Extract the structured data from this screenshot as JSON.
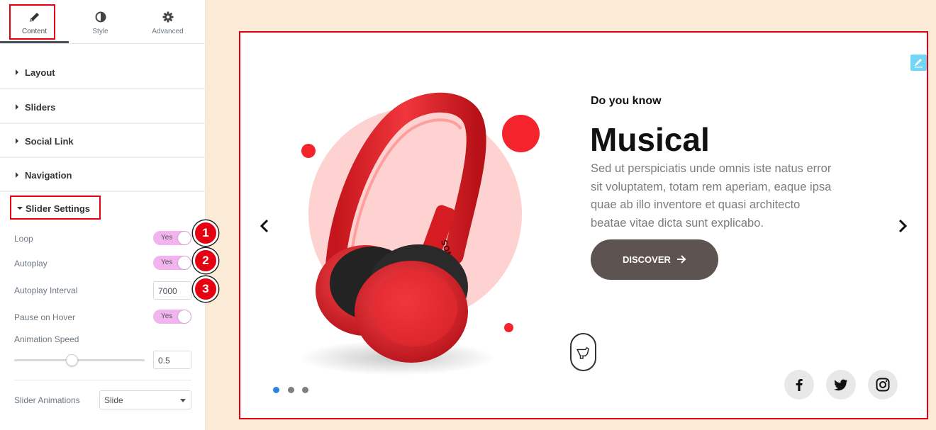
{
  "tabs": [
    {
      "label": "Content",
      "icon": "pencil-icon",
      "active": true
    },
    {
      "label": "Style",
      "icon": "contrast-icon",
      "active": false
    },
    {
      "label": "Advanced",
      "icon": "gear-icon",
      "active": false
    }
  ],
  "sections": [
    "Layout",
    "Sliders",
    "Social Link",
    "Navigation"
  ],
  "slider_settings": {
    "heading": "Slider Settings",
    "loop": {
      "label": "Loop",
      "value": "Yes"
    },
    "autoplay": {
      "label": "Autoplay",
      "value": "Yes"
    },
    "autoplay_interval": {
      "label": "Autoplay Interval",
      "value": "7000"
    },
    "pause_on_hover": {
      "label": "Pause on Hover",
      "value": "Yes"
    },
    "animation_speed": {
      "label": "Animation Speed",
      "value": "0.5",
      "slider_fraction": 0.45
    },
    "slider_animations": {
      "label": "Slider Animations",
      "value": "Slide"
    }
  },
  "badges": [
    "1",
    "2",
    "3"
  ],
  "slide": {
    "subheading": "Do you know",
    "title": "Musical",
    "text": "Sed ut perspiciatis unde omnis iste natus error sit voluptatem, totam rem aperiam, eaque ipsa quae ab illo inventore et quasi architecto beatae vitae dicta sunt explicabo.",
    "button": "DISCOVER",
    "product_brand": "SONY",
    "pagination": {
      "count": 3,
      "active": 1
    },
    "social": [
      "facebook-icon",
      "twitter-icon",
      "instagram-icon"
    ]
  },
  "colors": {
    "highlight": "#e60012",
    "toggle_on": "#f2b4ee",
    "canvas_bg": "#fbead6",
    "button": "#5d5350",
    "accent_dot": "#2b84e0",
    "headphone_red": "#e8242c"
  }
}
